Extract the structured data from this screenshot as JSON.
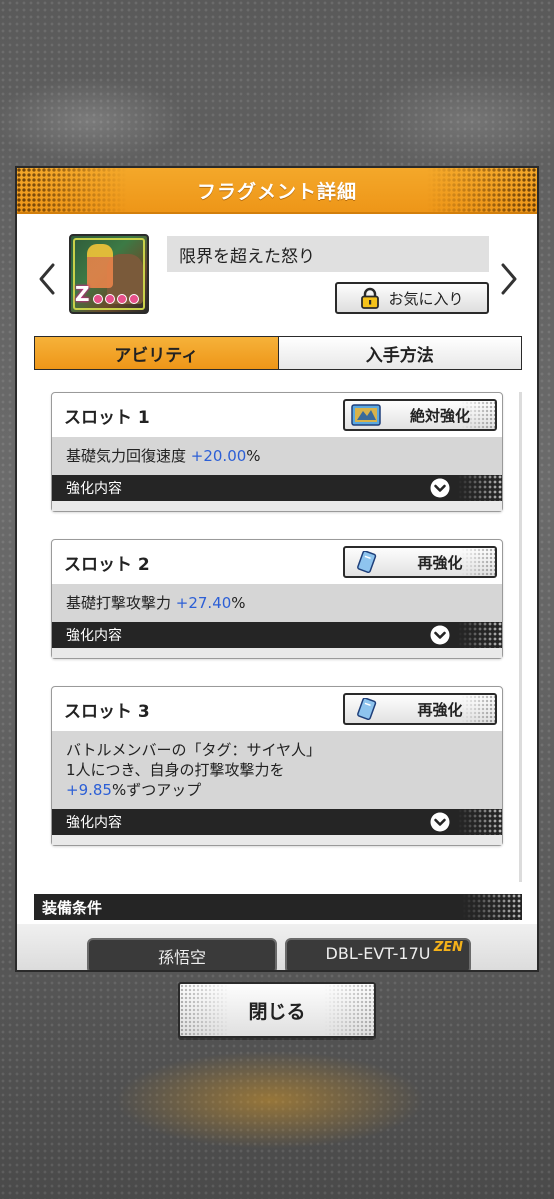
{
  "header": {
    "title": "フラグメント詳細"
  },
  "fragment": {
    "name": "限界を超えた怒り",
    "thumbnail_icon": "goku-fragment-thumbnail"
  },
  "favorite_button": {
    "label": "お気に入り",
    "icon": "lock-icon"
  },
  "tabs": [
    {
      "label": "アビリティ",
      "active": true
    },
    {
      "label": "入手方法",
      "active": false
    }
  ],
  "slots": [
    {
      "title": "スロット 1",
      "button": {
        "label": "絶対強化",
        "icon": "absolute-enhance-icon"
      },
      "desc_lines": [
        {
          "text": "基礎気力回復速度 ",
          "value": "+20.00",
          "suffix": "%"
        }
      ],
      "bar_label": "強化内容"
    },
    {
      "title": "スロット 2",
      "button": {
        "label": "再強化",
        "icon": "reenhance-icon"
      },
      "desc_lines": [
        {
          "text": "基礎打撃攻撃力 ",
          "value": "+27.40",
          "suffix": "%"
        }
      ],
      "bar_label": "強化内容"
    },
    {
      "title": "スロット 3",
      "button": {
        "label": "再強化",
        "icon": "reenhance-icon"
      },
      "desc_lines": [
        {
          "text": "バトルメンバーの「タグ：サイヤ人」"
        },
        {
          "text": "1人につき、自身の打撃攻撃力を"
        },
        {
          "text": "",
          "value": "+9.85",
          "suffix": "%ずつアップ"
        }
      ],
      "bar_label": "強化内容"
    }
  ],
  "equip": {
    "title": "装備条件",
    "chips": [
      {
        "label": "孫悟空"
      },
      {
        "label": "DBL-EVT-17U",
        "badge": "ZEN"
      }
    ]
  },
  "close_button": {
    "label": "閉じる"
  },
  "colors": {
    "accent_orange": "#ee9618",
    "value_blue": "#2c5fd6",
    "bar_dark": "#252525"
  }
}
